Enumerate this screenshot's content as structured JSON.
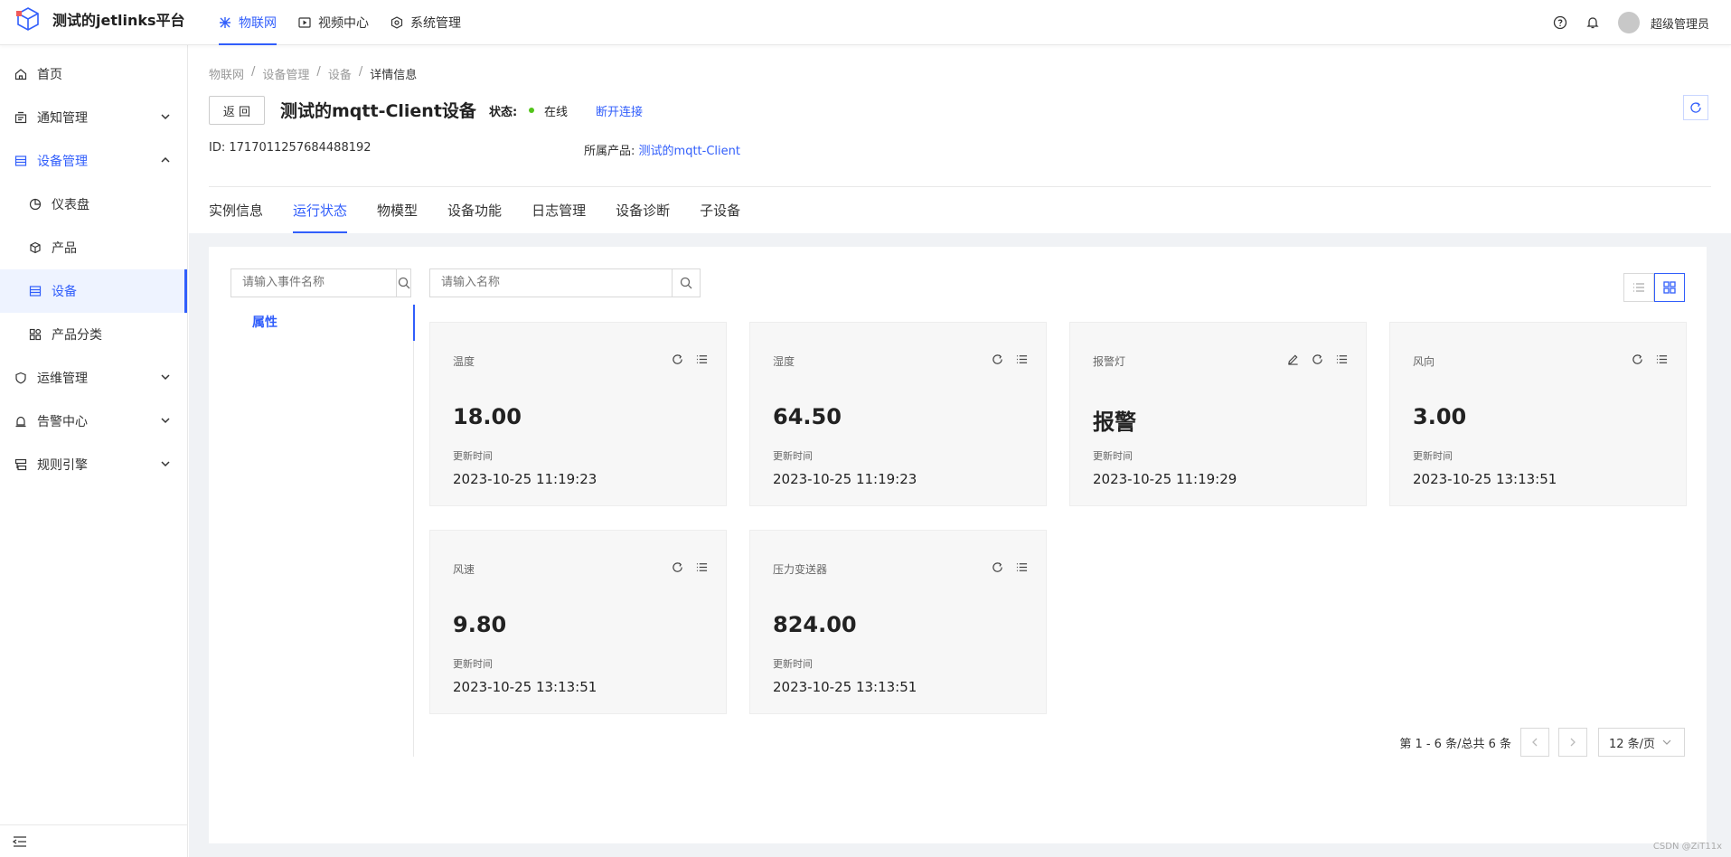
{
  "app": {
    "title": "测试的jetlinks平台"
  },
  "topnav": [
    {
      "label": "物联网",
      "icon": "iot-icon",
      "active": true
    },
    {
      "label": "视频中心",
      "icon": "video-icon",
      "active": false
    },
    {
      "label": "系统管理",
      "icon": "system-icon",
      "active": false
    }
  ],
  "user": {
    "name": "超级管理员"
  },
  "sidebar": {
    "items": [
      {
        "label": "首页",
        "icon": "home-icon"
      },
      {
        "label": "通知管理",
        "icon": "notification-icon"
      },
      {
        "label": "设备管理",
        "icon": "device-manage-icon"
      },
      {
        "label": "仪表盘",
        "icon": "dashboard-icon"
      },
      {
        "label": "产品",
        "icon": "product-icon"
      },
      {
        "label": "设备",
        "icon": "device-icon"
      },
      {
        "label": "产品分类",
        "icon": "category-icon"
      },
      {
        "label": "运维管理",
        "icon": "ops-icon"
      },
      {
        "label": "告警中心",
        "icon": "alarm-icon"
      },
      {
        "label": "规则引擎",
        "icon": "rule-icon"
      }
    ]
  },
  "breadcrumb": [
    "物联网",
    "设备管理",
    "设备",
    "详情信息"
  ],
  "device": {
    "back_label": "返 回",
    "name": "测试的mqtt-Client设备",
    "status_label": "状态:",
    "status_value": "在线",
    "disconnect_label": "断开连接",
    "id_label": "ID:",
    "id_value": "1717011257684488192",
    "product_label": "所属产品:",
    "product_value": "测试的mqtt-Client"
  },
  "tabs": [
    "实例信息",
    "运行状态",
    "物模型",
    "设备功能",
    "日志管理",
    "设备诊断",
    "子设备"
  ],
  "active_tab": "运行状态",
  "event_search": {
    "placeholder": "请输入事件名称"
  },
  "name_search": {
    "placeholder": "请输入名称"
  },
  "left_menu": {
    "property_label": "属性"
  },
  "update_label": "更新时间",
  "properties": [
    {
      "name": "温度",
      "value": "18.00",
      "time": "2023-10-25 11:19:23",
      "editable": false
    },
    {
      "name": "湿度",
      "value": "64.50",
      "time": "2023-10-25 11:19:23",
      "editable": false
    },
    {
      "name": "报警灯",
      "value": "报警",
      "time": "2023-10-25 11:19:29",
      "editable": true
    },
    {
      "name": "风向",
      "value": "3.00",
      "time": "2023-10-25 13:13:51",
      "editable": false
    },
    {
      "name": "风速",
      "value": "9.80",
      "time": "2023-10-25 13:13:51",
      "editable": false
    },
    {
      "name": "压力变送器",
      "value": "824.00",
      "time": "2023-10-25 13:13:51",
      "editable": false
    }
  ],
  "pagination": {
    "summary": "第 1 - 6 条/总共 6 条",
    "page_size": "12 条/页"
  },
  "watermark": "CSDN @ZiT11x",
  "colors": {
    "accent": "#315efb",
    "online": "#52c41a"
  }
}
